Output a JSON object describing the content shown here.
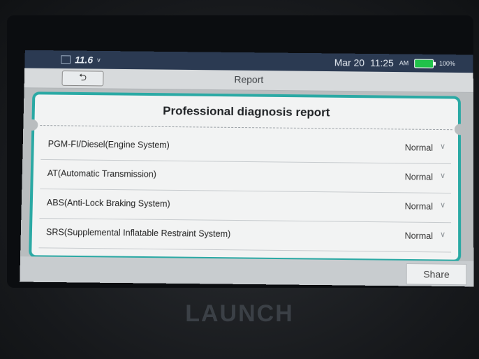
{
  "statusbar": {
    "voltage": "11.6",
    "voltage_unit": "v",
    "date": "Mar 20",
    "time": "11:25",
    "ampm": "AM",
    "battery": "100%",
    "battery_color": "#21c24a"
  },
  "titlebar": {
    "back_icon": "back-arrow-icon",
    "title": "Report"
  },
  "report": {
    "title": "Professional diagnosis report",
    "rows": [
      {
        "label": "PGM-FI/Diesel(Engine System)",
        "status": "Normal"
      },
      {
        "label": "AT(Automatic Transmission)",
        "status": "Normal"
      },
      {
        "label": "ABS(Anti-Lock Braking System)",
        "status": "Normal"
      },
      {
        "label": "SRS(Supplemental Inflatable Restraint System)",
        "status": "Normal"
      }
    ],
    "accent_color": "#2aa9a4"
  },
  "footer": {
    "share_label": "Share"
  },
  "device": {
    "brand": "LAUNCH"
  }
}
